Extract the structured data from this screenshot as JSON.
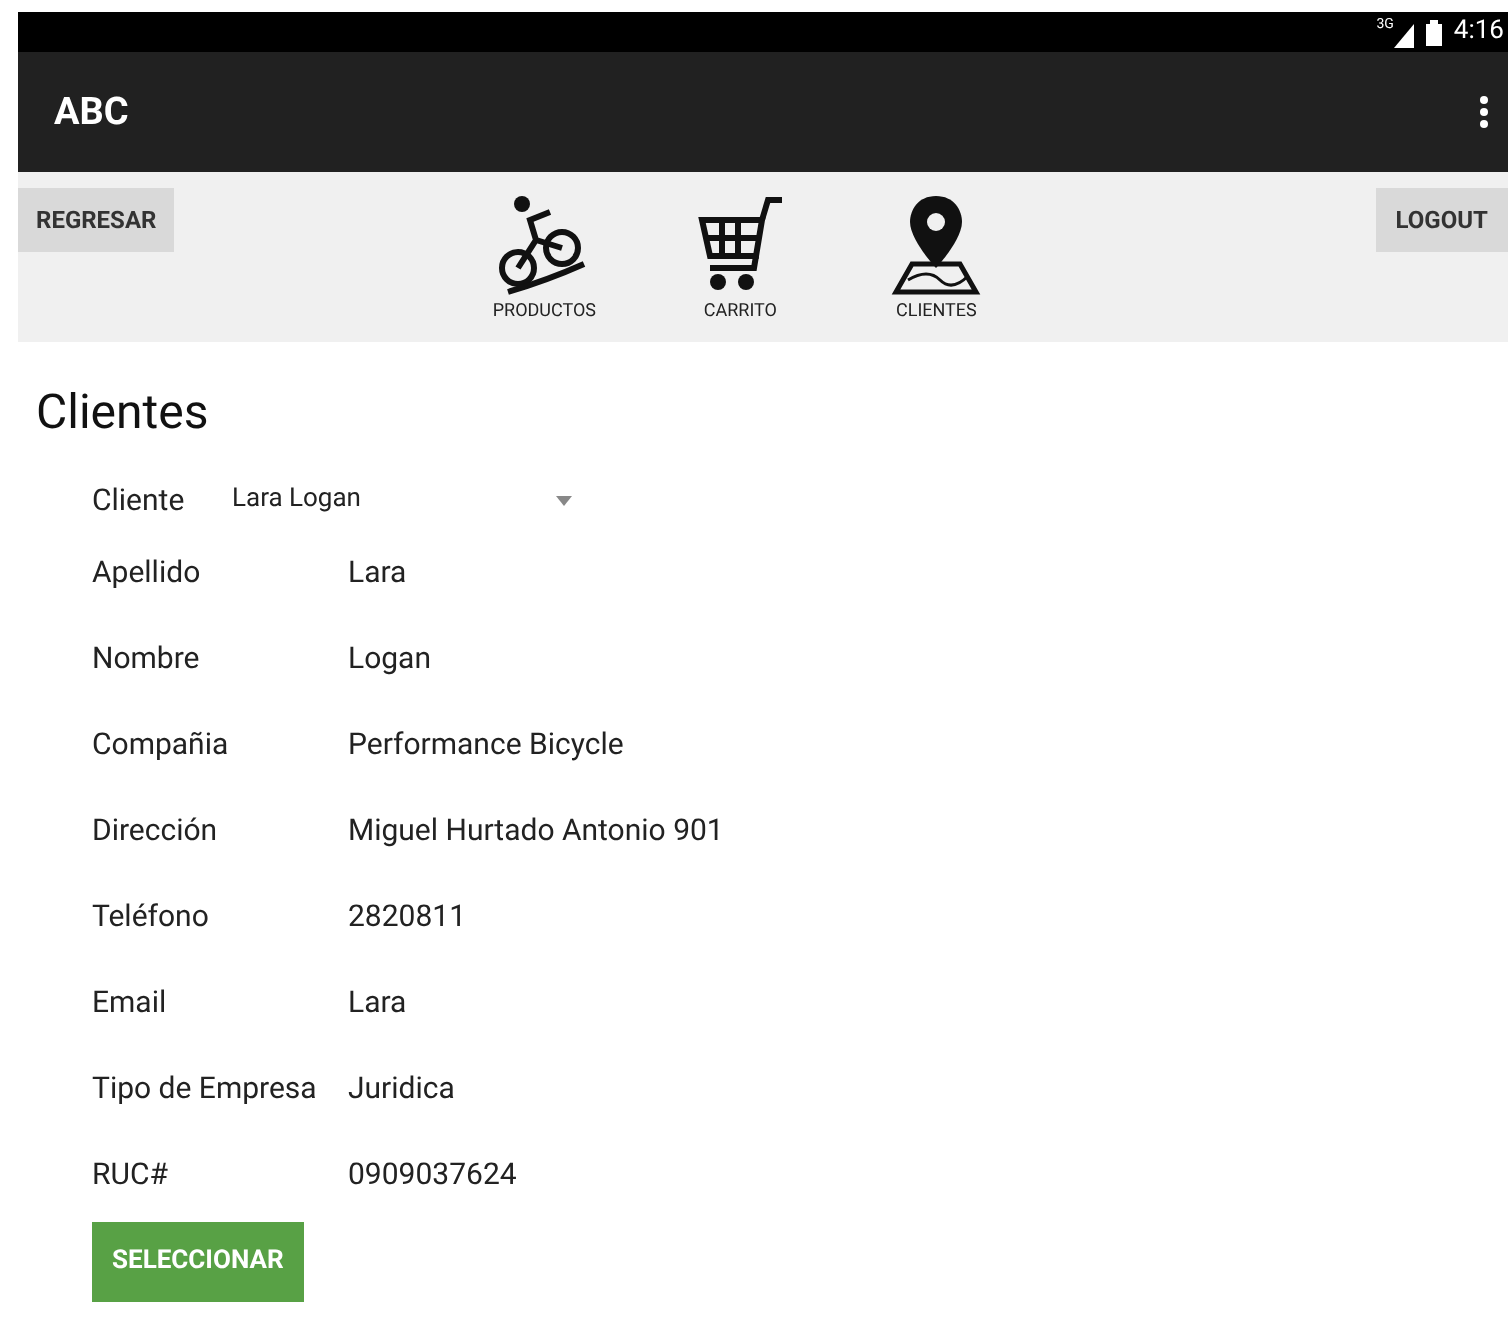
{
  "status_bar": {
    "network": "3G",
    "time": "4:16"
  },
  "app_bar": {
    "title": "ABC"
  },
  "nav": {
    "back": "REGRESAR",
    "logout": "LOGOUT",
    "items": [
      {
        "kind": "bike",
        "label": "PRODUCTOS"
      },
      {
        "kind": "cart",
        "label": "CARRITO"
      },
      {
        "kind": "map",
        "label": "CLIENTES"
      }
    ]
  },
  "page_title": "Clientes",
  "client_select": {
    "label": "Cliente",
    "value": "Lara Logan"
  },
  "fields": [
    {
      "label": "Apellido",
      "value": "Lara"
    },
    {
      "label": "Nombre",
      "value": "Logan"
    },
    {
      "label": "Compañia",
      "value": "Performance Bicycle"
    },
    {
      "label": "Dirección",
      "value": "Miguel Hurtado Antonio 901"
    },
    {
      "label": "Teléfono",
      "value": "2820811"
    },
    {
      "label": "Email",
      "value": "Lara"
    },
    {
      "label": "Tipo de Empresa",
      "value": "Juridica"
    },
    {
      "label": "RUC#",
      "value": "0909037624"
    }
  ],
  "primary_button": "SELECCIONAR"
}
